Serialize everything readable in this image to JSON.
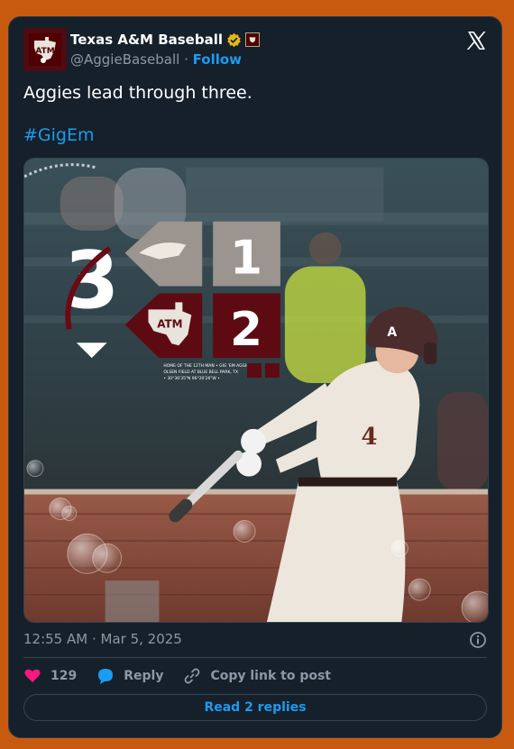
{
  "author": {
    "name": "Texas A&M Baseball",
    "handle": "@AggieBaseball",
    "separator": "·",
    "follow_label": "Follow"
  },
  "tweet": {
    "text": "Aggies lead through three.",
    "hashtag": "#GigEm"
  },
  "media": {
    "inning": "3",
    "score_opponent": "1",
    "score_home": "2",
    "jersey_number": "4",
    "fine_print_line1": "HOME OF THE 12TH MAN   •   GIG 'EM AGGIES",
    "fine_print_line2": "OLSEN FIELD AT BLUE BELL PARK, TX",
    "fine_print_line3": "• 30°36'35\"N  96°20'26\"W •"
  },
  "meta": {
    "timestamp": "12:55 AM · Mar 5, 2025"
  },
  "actions": {
    "like_count": "129",
    "reply_label": "Reply",
    "copy_label": "Copy link to post"
  },
  "read_replies_label": "Read 2 replies",
  "colors": {
    "background": "#c85a0f",
    "card": "#15202b",
    "accent": "#1d9bf0",
    "maroon": "#500000",
    "like": "#f91880"
  },
  "icons": [
    "verified-badge-icon",
    "affiliate-badge-icon",
    "x-logo-icon",
    "info-icon",
    "heart-icon",
    "reply-bubble-icon",
    "link-icon"
  ]
}
